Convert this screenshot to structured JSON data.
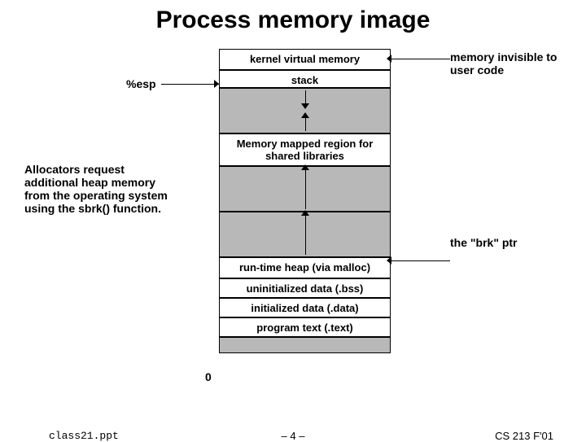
{
  "title": "Process memory image",
  "rows": {
    "kernel": "kernel virtual memory",
    "stack": "stack",
    "mmap": "Memory mapped region for shared libraries",
    "heap": "run-time heap (via malloc)",
    "bss": "uninitialized data (.bss)",
    "data": "initialized data (.data)",
    "text": "program text (.text)"
  },
  "annotations": {
    "invisible": "memory invisible to user code",
    "esp": "%esp",
    "allocators": "Allocators request additional heap memory from the operating system using the sbrk() function.",
    "brk": "the \"brk\" ptr",
    "zero": "0"
  },
  "footer": {
    "left": "class21.ppt",
    "center": "– 4 –",
    "right": "CS 213 F'01"
  }
}
